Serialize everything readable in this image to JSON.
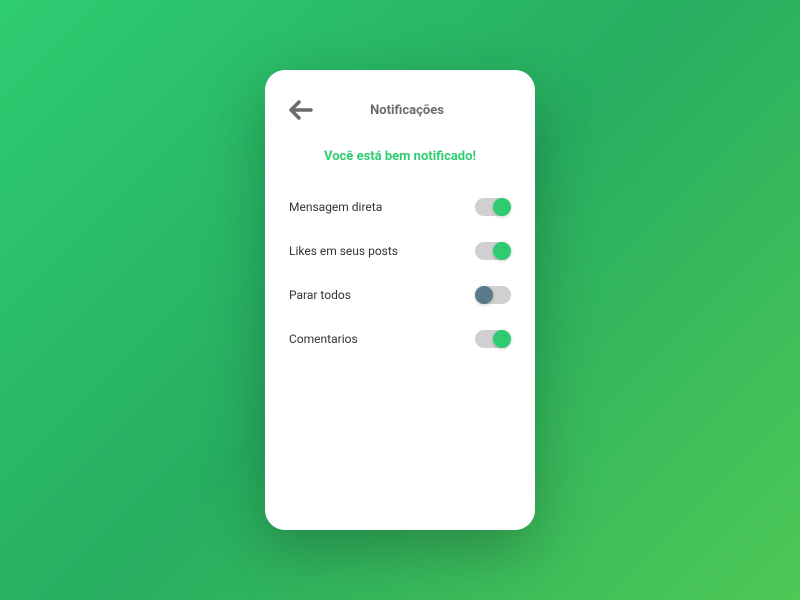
{
  "header": {
    "title": "Notificações"
  },
  "subtitle": "Você está bem notificado!",
  "settings": [
    {
      "label": "Mensagem direta",
      "on": true
    },
    {
      "label": "Likes em seus posts",
      "on": true
    },
    {
      "label": "Parar todos",
      "on": false
    },
    {
      "label": "Comentarios",
      "on": true
    }
  ],
  "colors": {
    "accent": "#2ecc71",
    "toggleOffThumb": "#5a7a8a",
    "toggleTrack": "#d0d0d0"
  }
}
